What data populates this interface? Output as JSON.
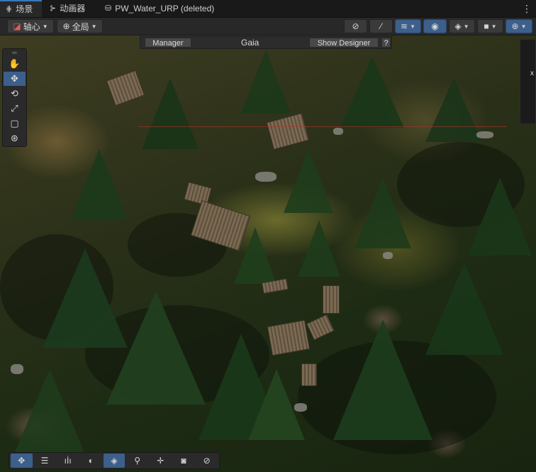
{
  "tabs": [
    {
      "label": "场景",
      "icon": "grid-icon",
      "active": true
    },
    {
      "label": "动画器",
      "icon": "animator-icon",
      "active": false
    },
    {
      "label": "PW_Water_URP (deleted)",
      "icon": "prefab-icon",
      "active": false
    }
  ],
  "tab_menu_icon": "⋮",
  "toolbar": {
    "pivot_label": "轴心",
    "global_label": "全局"
  },
  "gaia": {
    "manager_label": "Manager",
    "title": "Gaia",
    "show_designer_label": "Show Designer",
    "help_label": "?"
  },
  "right_panel": {
    "label": "x"
  },
  "colors": {
    "accent": "#3c5f8c",
    "tab_indicator": "#3a79bb"
  }
}
